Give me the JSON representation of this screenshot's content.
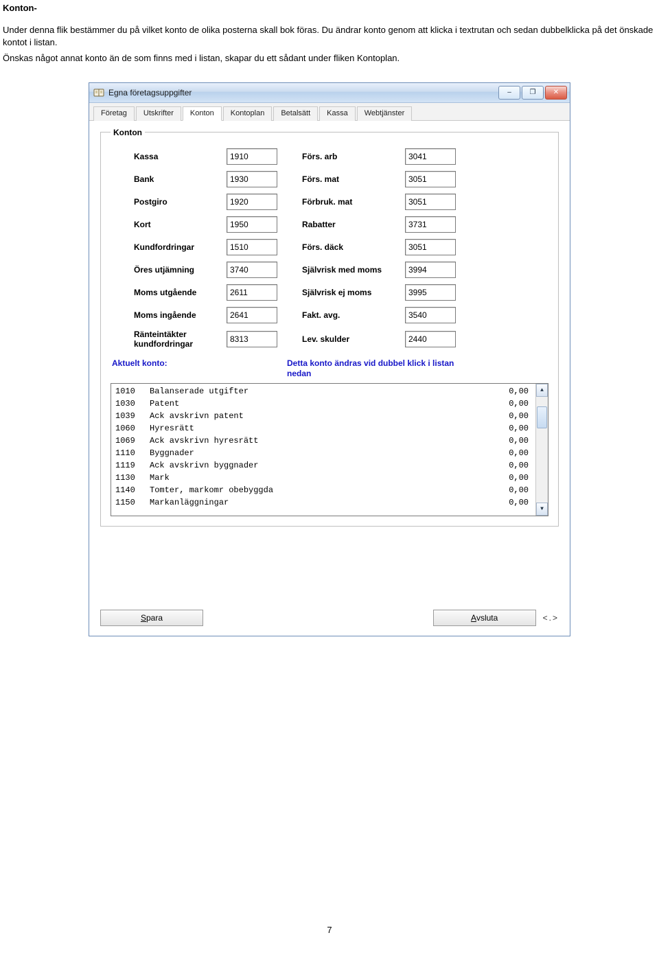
{
  "doc": {
    "heading": "Konton-",
    "para1": "Under denna flik bestämmer du på vilket konto de olika posterna skall bok föras. Du ändrar konto genom att klicka i textrutan och sedan dubbelklicka på det önskade kontot i listan.",
    "para2": "Önskas något annat konto än de som finns med i listan, skapar du ett sådant under fliken Kontoplan.",
    "page_number": "7"
  },
  "window": {
    "title": "Egna företagsuppgifter",
    "tabs": [
      "Företag",
      "Utskrifter",
      "Konton",
      "Kontoplan",
      "Betalsätt",
      "Kassa",
      "Webtjänster"
    ],
    "active_tab_index": 2,
    "groupbox_label": "Konton",
    "fields_left": [
      {
        "label": "Kassa",
        "value": "1910"
      },
      {
        "label": "Bank",
        "value": "1930"
      },
      {
        "label": "Postgiro",
        "value": "1920"
      },
      {
        "label": "Kort",
        "value": "1950"
      },
      {
        "label": "Kundfordringar",
        "value": "1510"
      },
      {
        "label": "Öres utjämning",
        "value": "3740"
      },
      {
        "label": "Moms utgående",
        "value": "2611"
      },
      {
        "label": "Moms ingående",
        "value": "2641"
      },
      {
        "label": "Ränteintäkter kundfordringar",
        "value": "8313"
      }
    ],
    "fields_right": [
      {
        "label": "Förs. arb",
        "value": "3041"
      },
      {
        "label": "Förs. mat",
        "value": "3051"
      },
      {
        "label": "Förbruk. mat",
        "value": "3051"
      },
      {
        "label": "Rabatter",
        "value": "3731"
      },
      {
        "label": "Förs. däck",
        "value": "3051"
      },
      {
        "label": "Självrisk med moms",
        "value": "3994"
      },
      {
        "label": "Självrisk ej moms",
        "value": "3995"
      },
      {
        "label": "Fakt. avg.",
        "value": "3540"
      },
      {
        "label": "Lev. skulder",
        "value": "2440"
      }
    ],
    "info_left": "Aktuelt konto:",
    "info_right": "Detta konto ändras vid dubbel klick i listan nedan",
    "list": [
      {
        "num": "1010",
        "text": "Balanserade utgifter",
        "val": "0,00"
      },
      {
        "num": "1030",
        "text": "Patent",
        "val": "0,00"
      },
      {
        "num": "1039",
        "text": "Ack avskrivn patent",
        "val": "0,00"
      },
      {
        "num": "1060",
        "text": "Hyresrätt",
        "val": "0,00"
      },
      {
        "num": "1069",
        "text": "Ack avskrivn hyresrätt",
        "val": "0,00"
      },
      {
        "num": "1110",
        "text": "Byggnader",
        "val": "0,00"
      },
      {
        "num": "1119",
        "text": "Ack avskrivn byggnader",
        "val": "0,00"
      },
      {
        "num": "1130",
        "text": "Mark",
        "val": "0,00"
      },
      {
        "num": "1140",
        "text": "Tomter, markomr obebyggda",
        "val": "0,00"
      },
      {
        "num": "1150",
        "text": "Markanläggningar",
        "val": "0,00"
      }
    ],
    "buttons": {
      "save_prefix": "S",
      "save_rest": "para",
      "close_prefix": "A",
      "close_rest": "vsluta",
      "nav_hint": "<.>"
    },
    "window_controls": {
      "min_glyph": "–",
      "max_glyph": "❐",
      "close_glyph": "✕"
    }
  }
}
